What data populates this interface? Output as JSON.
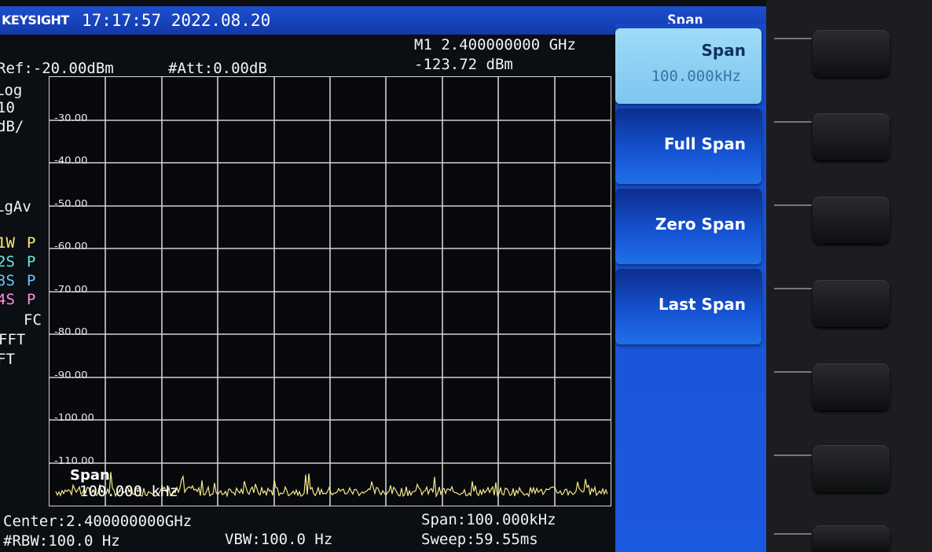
{
  "header": {
    "brand": "KEYSIGHT",
    "datetime": "17:17:57 2022.08.20",
    "menu_title": "Span"
  },
  "settings": {
    "ref": "Ref:-20.00dBm",
    "att": "#Att:0.00dB"
  },
  "marker": {
    "freq": "M1 2.400000000 GHz",
    "level": "-123.72 dBm"
  },
  "left_annotations": [
    {
      "text": "Log",
      "color": "#f3f3f3"
    },
    {
      "text": "10",
      "color": "#f3f3f3"
    },
    {
      "text": "dB/",
      "color": "#f3f3f3"
    },
    {
      "text": "LgAv",
      "color": "#f3f3f3"
    },
    {
      "text": "1W",
      "color": "#ffe97a"
    },
    {
      "text": "2S",
      "color": "#63e8e3"
    },
    {
      "text": "3S",
      "color": "#63c9ff"
    },
    {
      "text": "4S",
      "color": "#ff8de8"
    },
    {
      "text": "FC",
      "color": "#f3f3f3"
    },
    {
      "text": "FFT",
      "color": "#f3f3f3"
    },
    {
      "text": "FT",
      "color": "#f3f3f3"
    }
  ],
  "trace_flags": [
    {
      "text": "P",
      "color": "#ffe97a"
    },
    {
      "text": "P",
      "color": "#63e8e3"
    },
    {
      "text": "P",
      "color": "#63c9ff"
    },
    {
      "text": "P",
      "color": "#ff8de8"
    }
  ],
  "plot": {
    "y_labels": [
      "-30.00",
      "-40.00",
      "-50.00",
      "-60.00",
      "-70.00",
      "-80.00",
      "-90.00",
      "-100.00",
      "-110.00"
    ],
    "grid_divisions": 10,
    "trace_color": "#f5e98a",
    "overlay_label": "Span",
    "overlay_value": "100.000 kHz"
  },
  "footer": {
    "center": "Center:2.400000000GHz",
    "rbw": "#RBW:100.0 Hz",
    "vbw": "VBW:100.0 Hz",
    "span": "Span:100.000kHz",
    "sweep": "Sweep:59.55ms"
  },
  "softkeys": [
    {
      "label": "Span",
      "value": "100.000kHz",
      "active": true
    },
    {
      "label": "Full Span"
    },
    {
      "label": "Zero Span"
    },
    {
      "label": "Last Span"
    }
  ],
  "colors": {
    "accent_blue": "#1a54d6",
    "active_key": "#8fd2f3",
    "trace": "#f5e98a"
  }
}
